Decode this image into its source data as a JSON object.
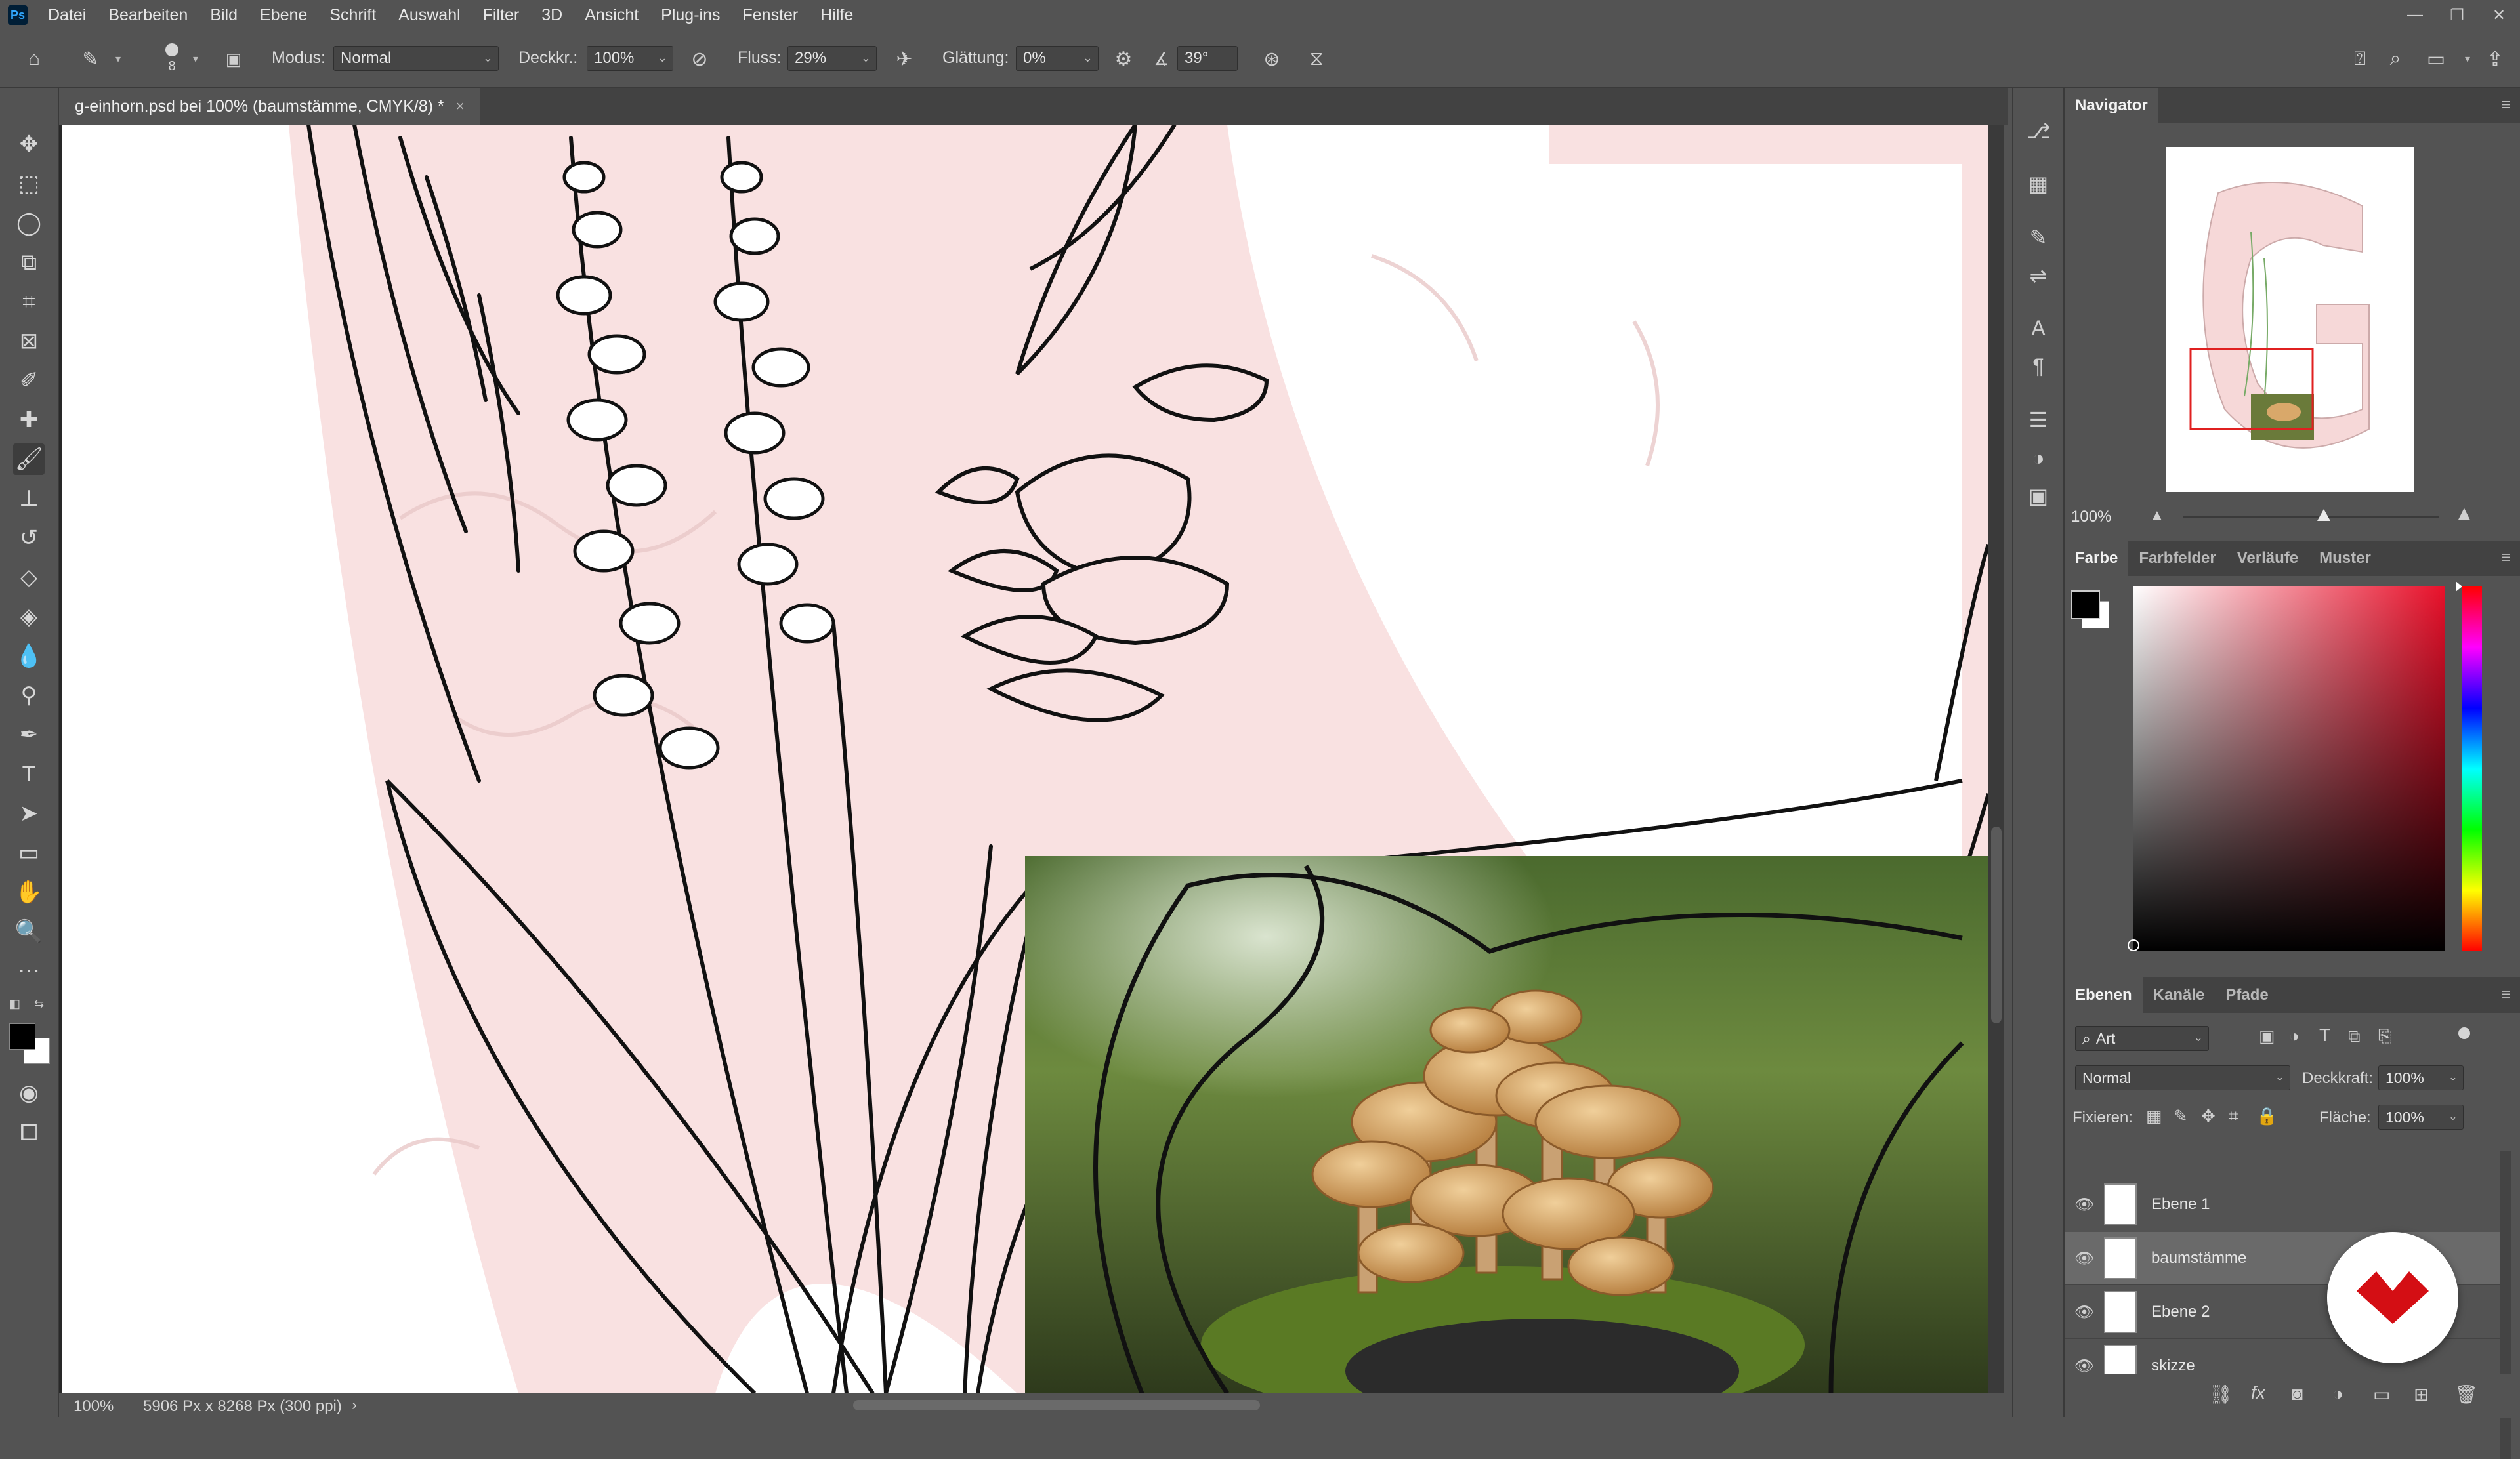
{
  "app": {
    "logo": "Ps"
  },
  "menu": [
    "Datei",
    "Bearbeiten",
    "Bild",
    "Ebene",
    "Schrift",
    "Auswahl",
    "Filter",
    "3D",
    "Ansicht",
    "Plug-ins",
    "Fenster",
    "Hilfe"
  ],
  "window_controls": {
    "minimize": "—",
    "restore": "❐",
    "close": "✕"
  },
  "options": {
    "brush_size": "8",
    "mode_label": "Modus:",
    "mode_value": "Normal",
    "opacity_label": "Deckkr.:",
    "opacity_value": "100%",
    "flow_label": "Fluss:",
    "flow_value": "29%",
    "smoothing_label": "Glättung:",
    "smoothing_value": "0%",
    "angle_value": "39°"
  },
  "document": {
    "tab_title": "g-einhorn.psd bei 100% (baumstämme, CMYK/8) *",
    "close": "×"
  },
  "status": {
    "zoom": "100%",
    "dimensions": "5906 Px x 8268 Px (300 ppi)",
    "arrow": "›"
  },
  "navigator": {
    "title": "Navigator",
    "zoom": "100%",
    "zoom_level": 0.55
  },
  "color_panel": {
    "tabs": [
      "Farbe",
      "Farbfelder",
      "Verläufe",
      "Muster"
    ],
    "foreground": "#000000",
    "background": "#ffffff",
    "hue_color": "#e8102a"
  },
  "layers_panel": {
    "tabs": [
      "Ebenen",
      "Kanäle",
      "Pfade"
    ],
    "filter_label": "Art",
    "blend_mode": "Normal",
    "opacity_label": "Deckkraft:",
    "opacity_value": "100%",
    "lock_label": "Fixieren:",
    "fill_label": "Fläche:",
    "fill_value": "100%",
    "layers": [
      {
        "name": "Ebene 1",
        "selected": false
      },
      {
        "name": "baumstämme",
        "selected": true
      },
      {
        "name": "Ebene 2",
        "selected": false
      },
      {
        "name": "skizze",
        "selected": false
      }
    ]
  },
  "colors": {
    "ui_bg": "#535353",
    "pink": "#f9e1e1",
    "sketch": "#111111"
  }
}
